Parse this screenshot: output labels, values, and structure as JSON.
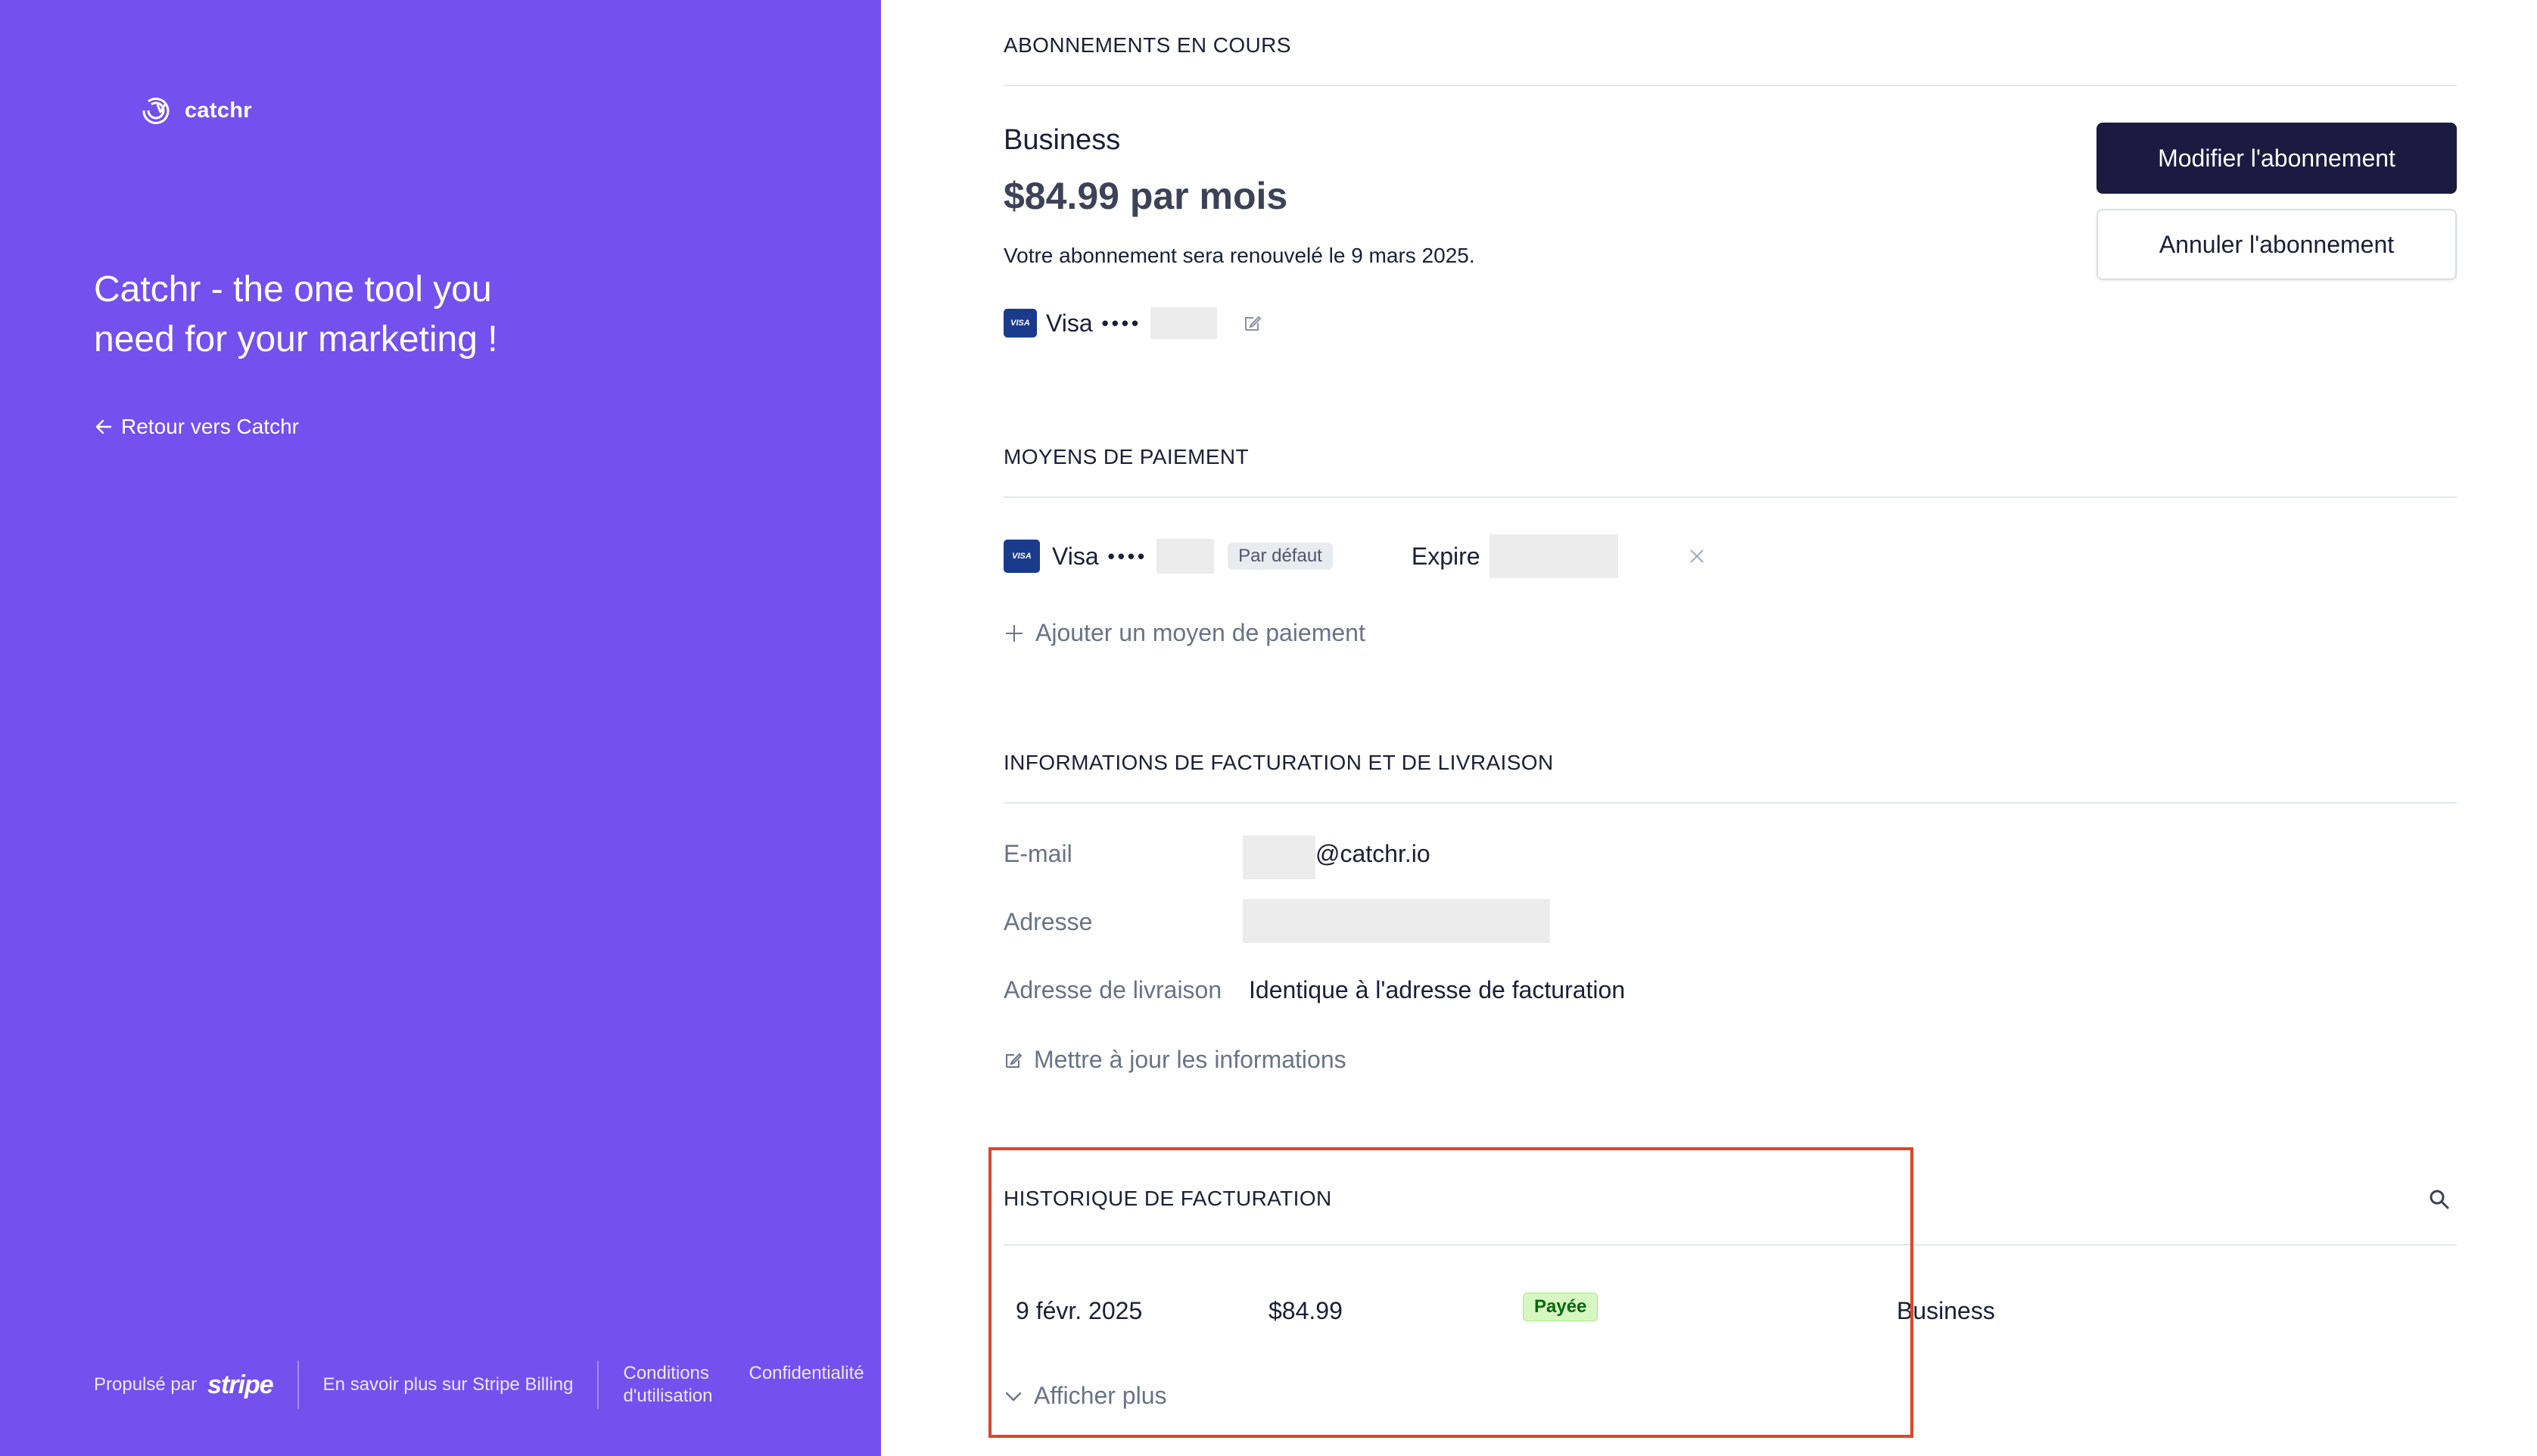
{
  "brand": {
    "name": "catchr",
    "accent": "#7450ee"
  },
  "left": {
    "tagline": "Catchr - the one tool you need for your marketing !",
    "back_link": "Retour vers Catchr",
    "footer": {
      "powered_by": "Propulsé par",
      "stripe": "stripe",
      "learn_more": "En savoir plus sur Stripe Billing",
      "terms_line1": "Conditions",
      "terms_line2": "d'utilisation",
      "privacy": "Confidentialité"
    }
  },
  "subscription": {
    "section_title": "ABONNEMENTS EN COURS",
    "plan_name": "Business",
    "price": "$84.99 par mois",
    "renewal": "Votre abonnement sera renouvelé le 9 mars 2025.",
    "card_brand": "Visa",
    "card_dots": "••••",
    "modify_button": "Modifier l'abonnement",
    "cancel_button": "Annuler l'abonnement"
  },
  "payment_methods": {
    "section_title": "MOYENS DE PAIEMENT",
    "card_brand": "Visa",
    "card_dots": "••••",
    "default_badge": "Par défaut",
    "expire_label": "Expire",
    "add_label": "Ajouter un moyen de paiement"
  },
  "billing_info": {
    "section_title": "INFORMATIONS DE FACTURATION ET DE LIVRAISON",
    "email_label": "E-mail",
    "email_value": "@catchr.io",
    "address_label": "Adresse",
    "shipping_label": "Adresse de livraison",
    "shipping_value": "Identique à l'adresse de facturation",
    "update_label": "Mettre à jour les informations"
  },
  "history": {
    "section_title": "HISTORIQUE DE FACTURATION",
    "rows": [
      {
        "date": "9 févr. 2025",
        "amount": "$84.99",
        "status": "Payée",
        "plan": "Business"
      }
    ],
    "show_more": "Afficher plus"
  }
}
